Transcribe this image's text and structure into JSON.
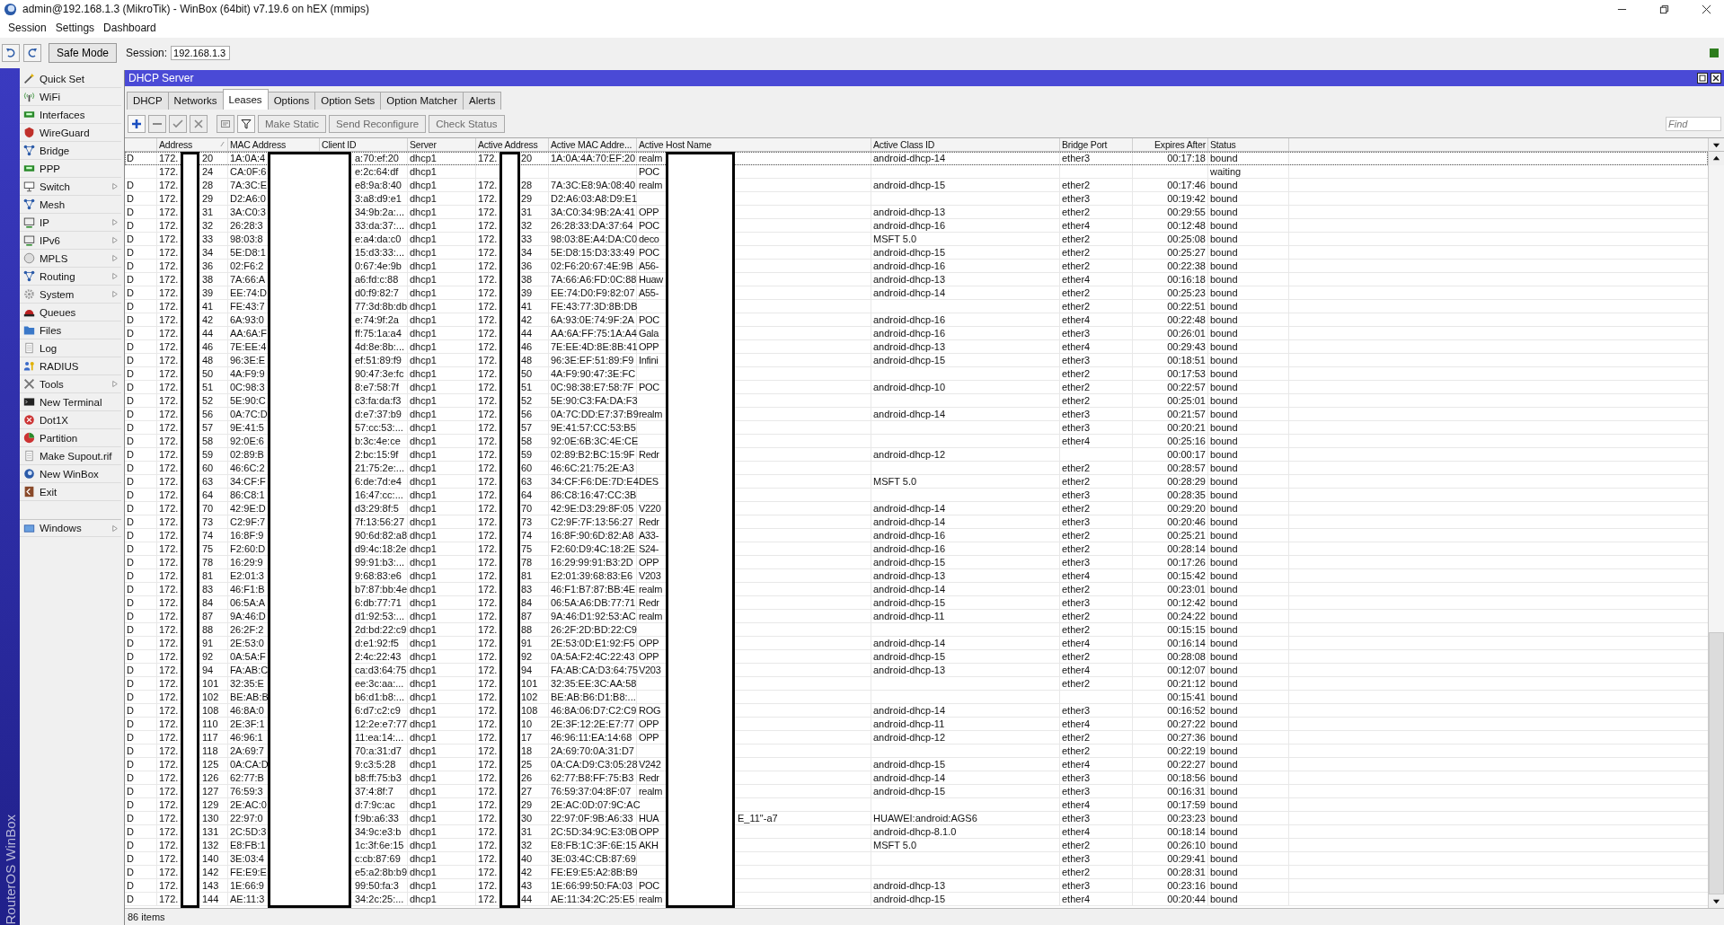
{
  "window": {
    "title": "admin@192.168.1.3 (MikroTik) - WinBox (64bit) v7.19.6 on hEX (mmips)"
  },
  "menu": [
    "Session",
    "Settings",
    "Dashboard"
  ],
  "toolbar": {
    "safe_mode": "Safe Mode",
    "session_label": "Session:",
    "session_value": "192.168.1.3"
  },
  "sidebar": {
    "brand": "RouterOS WinBox",
    "items": [
      {
        "label": "Quick Set",
        "submenu": false,
        "separated": false
      },
      {
        "label": "WiFi",
        "submenu": false,
        "separated": false
      },
      {
        "label": "Interfaces",
        "submenu": false,
        "separated": false
      },
      {
        "label": "WireGuard",
        "submenu": false,
        "separated": false
      },
      {
        "label": "Bridge",
        "submenu": false,
        "separated": false
      },
      {
        "label": "PPP",
        "submenu": false,
        "separated": false
      },
      {
        "label": "Switch",
        "submenu": true,
        "separated": false
      },
      {
        "label": "Mesh",
        "submenu": false,
        "separated": false
      },
      {
        "label": "IP",
        "submenu": true,
        "separated": false
      },
      {
        "label": "IPv6",
        "submenu": true,
        "separated": false
      },
      {
        "label": "MPLS",
        "submenu": true,
        "separated": false
      },
      {
        "label": "Routing",
        "submenu": true,
        "separated": false
      },
      {
        "label": "System",
        "submenu": true,
        "separated": false
      },
      {
        "label": "Queues",
        "submenu": false,
        "separated": false
      },
      {
        "label": "Files",
        "submenu": false,
        "separated": false
      },
      {
        "label": "Log",
        "submenu": false,
        "separated": false
      },
      {
        "label": "RADIUS",
        "submenu": false,
        "separated": false
      },
      {
        "label": "Tools",
        "submenu": true,
        "separated": false
      },
      {
        "label": "New Terminal",
        "submenu": false,
        "separated": false
      },
      {
        "label": "Dot1X",
        "submenu": false,
        "separated": false
      },
      {
        "label": "Partition",
        "submenu": false,
        "separated": false
      },
      {
        "label": "Make Supout.rif",
        "submenu": false,
        "separated": false
      },
      {
        "label": "New WinBox",
        "submenu": false,
        "separated": false
      },
      {
        "label": "Exit",
        "submenu": false,
        "separated": false
      },
      {
        "label": "Windows",
        "submenu": true,
        "separated": true
      }
    ]
  },
  "dhcp_window": {
    "title": "DHCP Server",
    "tabs": [
      {
        "label": "DHCP",
        "selected": false
      },
      {
        "label": "Networks",
        "selected": false
      },
      {
        "label": "Leases",
        "selected": true
      },
      {
        "label": "Options",
        "selected": false
      },
      {
        "label": "Option Sets",
        "selected": false
      },
      {
        "label": "Option Matcher",
        "selected": false
      },
      {
        "label": "Alerts",
        "selected": false
      }
    ],
    "tool_icons": [
      {
        "disabled": false
      },
      {
        "disabled": true
      },
      {
        "disabled": true
      },
      {
        "disabled": true
      },
      {
        "disabled": true
      },
      {
        "disabled": false
      }
    ],
    "buttons": [
      {
        "label": "Make Static",
        "disabled": true
      },
      {
        "label": "Send Reconfigure",
        "disabled": true
      },
      {
        "label": "Check Status",
        "disabled": true
      }
    ],
    "find": {
      "placeholder": "Find"
    },
    "table": {
      "columns": [
        {
          "label": "Address",
          "sorted": true
        },
        {
          "label": "MAC Address",
          "sorted": false
        },
        {
          "label": "Client ID",
          "sorted": false
        },
        {
          "label": "Server",
          "sorted": false
        },
        {
          "label": "Active Address",
          "sorted": false
        },
        {
          "label": "Active MAC Addre...",
          "sorted": false
        },
        {
          "label": "Active Host Name",
          "sorted": false
        },
        {
          "label": "Active Class ID",
          "sorted": false
        },
        {
          "label": "Bridge Port",
          "sorted": false
        },
        {
          "label": "Expires After",
          "sorted": false
        },
        {
          "label": "Status",
          "sorted": false
        }
      ],
      "rows": [
        {
          "flag": "D",
          "address": [
            "172.",
            "20"
          ],
          "mac": "1A:0A:4",
          "client_id": "a:70:ef:20",
          "server": "dhcp1",
          "active_address": [
            "172.",
            "20"
          ],
          "active_mac": "1A:0A:4A:70:EF:20",
          "host": [
            "realm"
          ],
          "class_id": "android-dhcp-14",
          "bridge_port": "ether3",
          "expires": "00:17:18",
          "status": "bound",
          "selected": true
        },
        {
          "address": [
            "172.",
            "24"
          ],
          "mac": "CA:0F:6",
          "client_id": "e:2c:64:df",
          "server": "dhcp1",
          "host": [
            "POC"
          ],
          "status": "waiting",
          "selected": false
        },
        {
          "flag": "D",
          "address": [
            "172.",
            "28"
          ],
          "mac": "7A:3C:E",
          "client_id": "e8:9a:8:40",
          "server": "dhcp1",
          "active_address": [
            "172.",
            "28"
          ],
          "active_mac": "7A:3C:E8:9A:08:40",
          "host": [
            "realm"
          ],
          "class_id": "android-dhcp-15",
          "bridge_port": "ether2",
          "expires": "00:17:46",
          "status": "bound",
          "selected": false
        },
        {
          "flag": "D",
          "address": [
            "172.",
            "29"
          ],
          "mac": "D2:A6:0",
          "client_id": "3:a8:d9:e1",
          "server": "dhcp1",
          "active_address": [
            "172.",
            "29"
          ],
          "active_mac": "D2:A6:03:A8:D9:E1",
          "bridge_port": "ether3",
          "expires": "00:19:42",
          "status": "bound",
          "selected": false
        },
        {
          "flag": "D",
          "address": [
            "172.",
            "31"
          ],
          "mac": "3A:C0:3",
          "client_id": "34:9b:2a:...",
          "server": "dhcp1",
          "active_address": [
            "172.",
            "31"
          ],
          "active_mac": "3A:C0:34:9B:2A:41",
          "host": [
            "OPP"
          ],
          "class_id": "android-dhcp-13",
          "bridge_port": "ether2",
          "expires": "00:29:55",
          "status": "bound",
          "selected": false
        },
        {
          "flag": "D",
          "address": [
            "172.",
            "32"
          ],
          "mac": "26:28:3",
          "client_id": "33:da:37:...",
          "server": "dhcp1",
          "active_address": [
            "172.",
            "32"
          ],
          "active_mac": "26:28:33:DA:37:64",
          "host": [
            "POC"
          ],
          "class_id": "android-dhcp-16",
          "bridge_port": "ether4",
          "expires": "00:12:48",
          "status": "bound",
          "selected": false
        },
        {
          "flag": "D",
          "address": [
            "172.",
            "33"
          ],
          "mac": "98:03:8",
          "client_id": "e:a4:da:c0",
          "server": "dhcp1",
          "active_address": [
            "172.",
            "33"
          ],
          "active_mac": "98:03:8E:A4:DA:C0",
          "host": [
            "deco"
          ],
          "class_id": "MSFT 5.0",
          "bridge_port": "ether2",
          "expires": "00:25:08",
          "status": "bound",
          "selected": false
        },
        {
          "flag": "D",
          "address": [
            "172.",
            "34"
          ],
          "mac": "5E:D8:1",
          "client_id": "15:d3:33:...",
          "server": "dhcp1",
          "active_address": [
            "172.",
            "34"
          ],
          "active_mac": "5E:D8:15:D3:33:49",
          "host": [
            "POC"
          ],
          "class_id": "android-dhcp-15",
          "bridge_port": "ether2",
          "expires": "00:25:27",
          "status": "bound",
          "selected": false
        },
        {
          "flag": "D",
          "address": [
            "172.",
            "36"
          ],
          "mac": "02:F6:2",
          "client_id": "0:67:4e:9b",
          "server": "dhcp1",
          "active_address": [
            "172.",
            "36"
          ],
          "active_mac": "02:F6:20:67:4E:9B",
          "host": [
            "A56-"
          ],
          "class_id": "android-dhcp-16",
          "bridge_port": "ether2",
          "expires": "00:22:38",
          "status": "bound",
          "selected": false
        },
        {
          "flag": "D",
          "address": [
            "172.",
            "38"
          ],
          "mac": "7A:66:A",
          "client_id": "a6:fd:c:88",
          "server": "dhcp1",
          "active_address": [
            "172.",
            "38"
          ],
          "active_mac": "7A:66:A6:FD:0C:88",
          "host": [
            "Huaw"
          ],
          "class_id": "android-dhcp-13",
          "bridge_port": "ether4",
          "expires": "00:16:18",
          "status": "bound",
          "selected": false
        },
        {
          "flag": "D",
          "address": [
            "172.",
            "39"
          ],
          "mac": "EE:74:D",
          "client_id": "d0:f9:82:7",
          "server": "dhcp1",
          "active_address": [
            "172.",
            "39"
          ],
          "active_mac": "EE:74:D0:F9:82:07",
          "host": [
            "A55-"
          ],
          "class_id": "android-dhcp-14",
          "bridge_port": "ether2",
          "expires": "00:25:23",
          "status": "bound",
          "selected": false
        },
        {
          "flag": "D",
          "address": [
            "172.",
            "41"
          ],
          "mac": "FE:43:7",
          "client_id": "77:3d:8b:db",
          "server": "dhcp1",
          "active_address": [
            "172.",
            "41"
          ],
          "active_mac": "FE:43:77:3D:8B:DB",
          "bridge_port": "ether2",
          "expires": "00:22:51",
          "status": "bound",
          "selected": false
        },
        {
          "flag": "D",
          "address": [
            "172.",
            "42"
          ],
          "mac": "6A:93:0",
          "client_id": "e:74:9f:2a",
          "server": "dhcp1",
          "active_address": [
            "172.",
            "42"
          ],
          "active_mac": "6A:93:0E:74:9F:2A",
          "host": [
            "POC"
          ],
          "class_id": "android-dhcp-16",
          "bridge_port": "ether4",
          "expires": "00:22:48",
          "status": "bound",
          "selected": false
        },
        {
          "flag": "D",
          "address": [
            "172.",
            "44"
          ],
          "mac": "AA:6A:F",
          "client_id": "ff:75:1a:a4",
          "server": "dhcp1",
          "active_address": [
            "172.",
            "44"
          ],
          "active_mac": "AA:6A:FF:75:1A:A4",
          "host": [
            "Gala"
          ],
          "class_id": "android-dhcp-16",
          "bridge_port": "ether3",
          "expires": "00:26:01",
          "status": "bound",
          "selected": false
        },
        {
          "flag": "D",
          "address": [
            "172.",
            "46"
          ],
          "mac": "7E:EE:4",
          "client_id": "4d:8e:8b:...",
          "server": "dhcp1",
          "active_address": [
            "172.",
            "46"
          ],
          "active_mac": "7E:EE:4D:8E:8B:41",
          "host": [
            "OPP"
          ],
          "class_id": "android-dhcp-13",
          "bridge_port": "ether4",
          "expires": "00:29:43",
          "status": "bound",
          "selected": false
        },
        {
          "flag": "D",
          "address": [
            "172.",
            "48"
          ],
          "mac": "96:3E:E",
          "client_id": "ef:51:89:f9",
          "server": "dhcp1",
          "active_address": [
            "172.",
            "48"
          ],
          "active_mac": "96:3E:EF:51:89:F9",
          "host": [
            "Infini"
          ],
          "class_id": "android-dhcp-15",
          "bridge_port": "ether3",
          "expires": "00:18:51",
          "status": "bound",
          "selected": false
        },
        {
          "flag": "D",
          "address": [
            "172.",
            "50"
          ],
          "mac": "4A:F9:9",
          "client_id": "90:47:3e:fc",
          "server": "dhcp1",
          "active_address": [
            "172.",
            "50"
          ],
          "active_mac": "4A:F9:90:47:3E:FC",
          "bridge_port": "ether2",
          "expires": "00:17:53",
          "status": "bound",
          "selected": false
        },
        {
          "flag": "D",
          "address": [
            "172.",
            "51"
          ],
          "mac": "0C:98:3",
          "client_id": "8:e7:58:7f",
          "server": "dhcp1",
          "active_address": [
            "172.",
            "51"
          ],
          "active_mac": "0C:98:38:E7:58:7F",
          "host": [
            "POC"
          ],
          "class_id": "android-dhcp-10",
          "bridge_port": "ether2",
          "expires": "00:22:57",
          "status": "bound",
          "selected": false
        },
        {
          "flag": "D",
          "address": [
            "172.",
            "52"
          ],
          "mac": "5E:90:C",
          "client_id": "c3:fa:da:f3",
          "server": "dhcp1",
          "active_address": [
            "172.",
            "52"
          ],
          "active_mac": "5E:90:C3:FA:DA:F3",
          "bridge_port": "ether2",
          "expires": "00:25:01",
          "status": "bound",
          "selected": false
        },
        {
          "flag": "D",
          "address": [
            "172.",
            "56"
          ],
          "mac": "0A:7C:D",
          "client_id": "d:e7:37:b9",
          "server": "dhcp1",
          "active_address": [
            "172.",
            "56"
          ],
          "active_mac": "0A:7C:DD:E7:37:B9",
          "host": [
            "realm"
          ],
          "class_id": "android-dhcp-14",
          "bridge_port": "ether3",
          "expires": "00:21:57",
          "status": "bound",
          "selected": false
        },
        {
          "flag": "D",
          "address": [
            "172.",
            "57"
          ],
          "mac": "9E:41:5",
          "client_id": "57:cc:53:...",
          "server": "dhcp1",
          "active_address": [
            "172.",
            "57"
          ],
          "active_mac": "9E:41:57:CC:53:B5",
          "bridge_port": "ether3",
          "expires": "00:20:21",
          "status": "bound",
          "selected": false
        },
        {
          "flag": "D",
          "address": [
            "172.",
            "58"
          ],
          "mac": "92:0E:6",
          "client_id": "b:3c:4e:ce",
          "server": "dhcp1",
          "active_address": [
            "172.",
            "58"
          ],
          "active_mac": "92:0E:6B:3C:4E:CE",
          "bridge_port": "ether4",
          "expires": "00:25:16",
          "status": "bound",
          "selected": false
        },
        {
          "flag": "D",
          "address": [
            "172.",
            "59"
          ],
          "mac": "02:89:B",
          "client_id": "2:bc:15:9f",
          "server": "dhcp1",
          "active_address": [
            "172.",
            "59"
          ],
          "active_mac": "02:89:B2:BC:15:9F",
          "host": [
            "Redr"
          ],
          "class_id": "android-dhcp-12",
          "expires": "00:00:17",
          "status": "bound",
          "selected": false
        },
        {
          "flag": "D",
          "address": [
            "172.",
            "60"
          ],
          "mac": "46:6C:2",
          "client_id": "21:75:2e:...",
          "server": "dhcp1",
          "active_address": [
            "172.",
            "60"
          ],
          "active_mac": "46:6C:21:75:2E:A3",
          "bridge_port": "ether2",
          "expires": "00:28:57",
          "status": "bound",
          "selected": false
        },
        {
          "flag": "D",
          "address": [
            "172.",
            "63"
          ],
          "mac": "34:CF:F",
          "client_id": "6:de:7d:e4",
          "server": "dhcp1",
          "active_address": [
            "172.",
            "63"
          ],
          "active_mac": "34:CF:F6:DE:7D:E4",
          "host": [
            "DES"
          ],
          "class_id": "MSFT 5.0",
          "bridge_port": "ether2",
          "expires": "00:28:29",
          "status": "bound",
          "selected": false
        },
        {
          "flag": "D",
          "address": [
            "172.",
            "64"
          ],
          "mac": "86:C8:1",
          "client_id": "16:47:cc:...",
          "server": "dhcp1",
          "active_address": [
            "172.",
            "64"
          ],
          "active_mac": "86:C8:16:47:CC:3B",
          "bridge_port": "ether3",
          "expires": "00:28:35",
          "status": "bound",
          "selected": false
        },
        {
          "flag": "D",
          "address": [
            "172.",
            "70"
          ],
          "mac": "42:9E:D",
          "client_id": "d3:29:8f:5",
          "server": "dhcp1",
          "active_address": [
            "172.",
            "70"
          ],
          "active_mac": "42:9E:D3:29:8F:05",
          "host": [
            "V220"
          ],
          "class_id": "android-dhcp-14",
          "bridge_port": "ether2",
          "expires": "00:29:20",
          "status": "bound",
          "selected": false
        },
        {
          "flag": "D",
          "address": [
            "172.",
            "73"
          ],
          "mac": "C2:9F:7",
          "client_id": "7f:13:56:27",
          "server": "dhcp1",
          "active_address": [
            "172.",
            "73"
          ],
          "active_mac": "C2:9F:7F:13:56:27",
          "host": [
            "Redr"
          ],
          "class_id": "android-dhcp-14",
          "bridge_port": "ether3",
          "expires": "00:20:46",
          "status": "bound",
          "selected": false
        },
        {
          "flag": "D",
          "address": [
            "172.",
            "74"
          ],
          "mac": "16:8F:9",
          "client_id": "90:6d:82:a8",
          "server": "dhcp1",
          "active_address": [
            "172.",
            "74"
          ],
          "active_mac": "16:8F:90:6D:82:A8",
          "host": [
            "A33-"
          ],
          "class_id": "android-dhcp-16",
          "bridge_port": "ether2",
          "expires": "00:25:21",
          "status": "bound",
          "selected": false
        },
        {
          "flag": "D",
          "address": [
            "172.",
            "75"
          ],
          "mac": "F2:60:D",
          "client_id": "d9:4c:18:2e",
          "server": "dhcp1",
          "active_address": [
            "172.",
            "75"
          ],
          "active_mac": "F2:60:D9:4C:18:2E",
          "host": [
            "S24-"
          ],
          "class_id": "android-dhcp-16",
          "bridge_port": "ether2",
          "expires": "00:28:14",
          "status": "bound",
          "selected": false
        },
        {
          "flag": "D",
          "address": [
            "172.",
            "78"
          ],
          "mac": "16:29:9",
          "client_id": "99:91:b3:...",
          "server": "dhcp1",
          "active_address": [
            "172.",
            "78"
          ],
          "active_mac": "16:29:99:91:B3:2D",
          "host": [
            "OPP"
          ],
          "class_id": "android-dhcp-15",
          "bridge_port": "ether3",
          "expires": "00:17:26",
          "status": "bound",
          "selected": false
        },
        {
          "flag": "D",
          "address": [
            "172.",
            "81"
          ],
          "mac": "E2:01:3",
          "client_id": "9:68:83:e6",
          "server": "dhcp1",
          "active_address": [
            "172.",
            "81"
          ],
          "active_mac": "E2:01:39:68:83:E6",
          "host": [
            "V203"
          ],
          "class_id": "android-dhcp-13",
          "bridge_port": "ether4",
          "expires": "00:15:42",
          "status": "bound",
          "selected": false
        },
        {
          "flag": "D",
          "address": [
            "172.",
            "83"
          ],
          "mac": "46:F1:B",
          "client_id": "b7:87:bb:4e",
          "server": "dhcp1",
          "active_address": [
            "172.",
            "83"
          ],
          "active_mac": "46:F1:B7:87:BB:4E",
          "host": [
            "realm"
          ],
          "class_id": "android-dhcp-14",
          "bridge_port": "ether2",
          "expires": "00:23:01",
          "status": "bound",
          "selected": false
        },
        {
          "flag": "D",
          "address": [
            "172.",
            "84"
          ],
          "mac": "06:5A:A",
          "client_id": "6:db:77:71",
          "server": "dhcp1",
          "active_address": [
            "172.",
            "84"
          ],
          "active_mac": "06:5A:A6:DB:77:71",
          "host": [
            "Redr"
          ],
          "class_id": "android-dhcp-15",
          "bridge_port": "ether3",
          "expires": "00:12:42",
          "status": "bound",
          "selected": false
        },
        {
          "flag": "D",
          "address": [
            "172.",
            "87"
          ],
          "mac": "9A:46:D",
          "client_id": "d1:92:53:...",
          "server": "dhcp1",
          "active_address": [
            "172.",
            "87"
          ],
          "active_mac": "9A:46:D1:92:53:AC",
          "host": [
            "realm"
          ],
          "class_id": "android-dhcp-11",
          "bridge_port": "ether2",
          "expires": "00:24:22",
          "status": "bound",
          "selected": false
        },
        {
          "flag": "D",
          "address": [
            "172.",
            "88"
          ],
          "mac": "26:2F:2",
          "client_id": "2d:bd:22:c9",
          "server": "dhcp1",
          "active_address": [
            "172.",
            "88"
          ],
          "active_mac": "26:2F:2D:BD:22:C9",
          "bridge_port": "ether2",
          "expires": "00:15:15",
          "status": "bound",
          "selected": false
        },
        {
          "flag": "D",
          "address": [
            "172.",
            "91"
          ],
          "mac": "2E:53:0",
          "client_id": "d:e1:92:f5",
          "server": "dhcp1",
          "active_address": [
            "172.",
            "91"
          ],
          "active_mac": "2E:53:0D:E1:92:F5",
          "host": [
            "OPP"
          ],
          "class_id": "android-dhcp-14",
          "bridge_port": "ether4",
          "expires": "00:16:14",
          "status": "bound",
          "selected": false
        },
        {
          "flag": "D",
          "address": [
            "172.",
            "92"
          ],
          "mac": "0A:5A:F",
          "client_id": "2:4c:22:43",
          "server": "dhcp1",
          "active_address": [
            "172.",
            "92"
          ],
          "active_mac": "0A:5A:F2:4C:22:43",
          "host": [
            "OPP"
          ],
          "class_id": "android-dhcp-15",
          "bridge_port": "ether2",
          "expires": "00:28:08",
          "status": "bound",
          "selected": false
        },
        {
          "flag": "D",
          "address": [
            "172.",
            "94"
          ],
          "mac": "FA:AB:C",
          "client_id": "ca:d3:64:75",
          "server": "dhcp1",
          "active_address": [
            "172.",
            "94"
          ],
          "active_mac": "FA:AB:CA:D3:64:75",
          "host": [
            "V203"
          ],
          "class_id": "android-dhcp-13",
          "bridge_port": "ether4",
          "expires": "00:12:07",
          "status": "bound",
          "selected": false
        },
        {
          "flag": "D",
          "address": [
            "172.",
            "101"
          ],
          "mac": "32:35:E",
          "client_id": "ee:3c:aa:...",
          "server": "dhcp1",
          "active_address": [
            "172.",
            "101"
          ],
          "active_mac": "32:35:EE:3C:AA:58",
          "bridge_port": "ether2",
          "expires": "00:21:12",
          "status": "bound",
          "selected": false
        },
        {
          "flag": "D",
          "address": [
            "172.",
            "102"
          ],
          "mac": "BE:AB:B",
          "client_id": "b6:d1:b8:...",
          "server": "dhcp1",
          "active_address": [
            "172.",
            "102"
          ],
          "active_mac": "BE:AB:B6:D1:B8:...",
          "expires": "00:15:41",
          "status": "bound",
          "selected": false
        },
        {
          "flag": "D",
          "address": [
            "172.",
            "108"
          ],
          "mac": "46:8A:0",
          "client_id": "6:d7:c2:c9",
          "server": "dhcp1",
          "active_address": [
            "172.",
            "108"
          ],
          "active_mac": "46:8A:06:D7:C2:C9",
          "host": [
            "ROG"
          ],
          "class_id": "android-dhcp-14",
          "bridge_port": "ether3",
          "expires": "00:16:52",
          "status": "bound",
          "selected": false
        },
        {
          "flag": "D",
          "address": [
            "172.",
            "110"
          ],
          "mac": "2E:3F:1",
          "client_id": "12:2e:e7:77",
          "server": "dhcp1",
          "active_address": [
            "172.",
            "10"
          ],
          "active_mac": "2E:3F:12:2E:E7:77",
          "host": [
            "OPP"
          ],
          "class_id": "android-dhcp-11",
          "bridge_port": "ether4",
          "expires": "00:27:22",
          "status": "bound",
          "selected": false
        },
        {
          "flag": "D",
          "address": [
            "172.",
            "117"
          ],
          "mac": "46:96:1",
          "client_id": "11:ea:14:...",
          "server": "dhcp1",
          "active_address": [
            "172.",
            "17"
          ],
          "active_mac": "46:96:11:EA:14:68",
          "host": [
            "OPP"
          ],
          "class_id": "android-dhcp-12",
          "bridge_port": "ether2",
          "expires": "00:27:36",
          "status": "bound",
          "selected": false
        },
        {
          "flag": "D",
          "address": [
            "172.",
            "118"
          ],
          "mac": "2A:69:7",
          "client_id": "70:a:31:d7",
          "server": "dhcp1",
          "active_address": [
            "172.",
            "18"
          ],
          "active_mac": "2A:69:70:0A:31:D7",
          "bridge_port": "ether2",
          "expires": "00:22:19",
          "status": "bound",
          "selected": false
        },
        {
          "flag": "D",
          "address": [
            "172.",
            "125"
          ],
          "mac": "0A:CA:D",
          "client_id": "9:c3:5:28",
          "server": "dhcp1",
          "active_address": [
            "172.",
            "25"
          ],
          "active_mac": "0A:CA:D9:C3:05:28",
          "host": [
            "V242"
          ],
          "class_id": "android-dhcp-15",
          "bridge_port": "ether4",
          "expires": "00:22:27",
          "status": "bound",
          "selected": false
        },
        {
          "flag": "D",
          "address": [
            "172.",
            "126"
          ],
          "mac": "62:77:B",
          "client_id": "b8:ff:75:b3",
          "server": "dhcp1",
          "active_address": [
            "172.",
            "26"
          ],
          "active_mac": "62:77:B8:FF:75:B3",
          "host": [
            "Redr"
          ],
          "class_id": "android-dhcp-14",
          "bridge_port": "ether3",
          "expires": "00:18:56",
          "status": "bound",
          "selected": false
        },
        {
          "flag": "D",
          "address": [
            "172.",
            "127"
          ],
          "mac": "76:59:3",
          "client_id": "37:4:8f:7",
          "server": "dhcp1",
          "active_address": [
            "172.",
            "27"
          ],
          "active_mac": "76:59:37:04:8F:07",
          "host": [
            "realm"
          ],
          "class_id": "android-dhcp-15",
          "bridge_port": "ether3",
          "expires": "00:16:31",
          "status": "bound",
          "selected": false
        },
        {
          "flag": "D",
          "address": [
            "172.",
            "129"
          ],
          "mac": "2E:AC:0",
          "client_id": "d:7:9c:ac",
          "server": "dhcp1",
          "active_address": [
            "172.",
            "29"
          ],
          "active_mac": "2E:AC:0D:07:9C:AC",
          "bridge_port": "ether4",
          "expires": "00:17:59",
          "status": "bound",
          "selected": false
        },
        {
          "flag": "D",
          "address": [
            "172.",
            "130"
          ],
          "mac": "22:97:0",
          "client_id": "f:9b:a6:33",
          "server": "dhcp1",
          "active_address": [
            "172.",
            "30"
          ],
          "active_mac": "22:97:0F:9B:A6:33",
          "host": [
            "HUA",
            "E_11\"-a7"
          ],
          "class_id": "HUAWEI:android:AGS6",
          "bridge_port": "ether3",
          "expires": "00:23:23",
          "status": "bound",
          "selected": false
        },
        {
          "flag": "D",
          "address": [
            "172.",
            "131"
          ],
          "mac": "2C:5D:3",
          "client_id": "34:9c:e3:b",
          "server": "dhcp1",
          "active_address": [
            "172.",
            "31"
          ],
          "active_mac": "2C:5D:34:9C:E3:0B",
          "host": [
            "OPP"
          ],
          "class_id": "android-dhcp-8.1.0",
          "bridge_port": "ether4",
          "expires": "00:18:14",
          "status": "bound",
          "selected": false
        },
        {
          "flag": "D",
          "address": [
            "172.",
            "132"
          ],
          "mac": "E8:FB:1",
          "client_id": "1c:3f:6e:15",
          "server": "dhcp1",
          "active_address": [
            "172.",
            "32"
          ],
          "active_mac": "E8:FB:1C:3F:6E:15",
          "host": [
            "AKH"
          ],
          "class_id": "MSFT 5.0",
          "bridge_port": "ether2",
          "expires": "00:26:10",
          "status": "bound",
          "selected": false
        },
        {
          "flag": "D",
          "address": [
            "172.",
            "140"
          ],
          "mac": "3E:03:4",
          "client_id": "c:cb:87:69",
          "server": "dhcp1",
          "active_address": [
            "172.",
            "40"
          ],
          "active_mac": "3E:03:4C:CB:87:69",
          "bridge_port": "ether3",
          "expires": "00:29:41",
          "status": "bound",
          "selected": false
        },
        {
          "flag": "D",
          "address": [
            "172.",
            "142"
          ],
          "mac": "FE:E9:E",
          "client_id": "e5:a2:8b:b9",
          "server": "dhcp1",
          "active_address": [
            "172.",
            "42"
          ],
          "active_mac": "FE:E9:E5:A2:8B:B9",
          "bridge_port": "ether2",
          "expires": "00:28:31",
          "status": "bound",
          "selected": false
        },
        {
          "flag": "D",
          "address": [
            "172.",
            "143"
          ],
          "mac": "1E:66:9",
          "client_id": "99:50:fa:3",
          "server": "dhcp1",
          "active_address": [
            "172.",
            "43"
          ],
          "active_mac": "1E:66:99:50:FA:03",
          "host": [
            "POC"
          ],
          "class_id": "android-dhcp-13",
          "bridge_port": "ether3",
          "expires": "00:23:16",
          "status": "bound",
          "selected": false
        },
        {
          "flag": "D",
          "address": [
            "172.",
            "144"
          ],
          "mac": "AE:11:3",
          "client_id": "34:2c:25:...",
          "server": "dhcp1",
          "active_address": [
            "172.",
            "44"
          ],
          "active_mac": "AE:11:34:2C:25:E5",
          "host": [
            "realm"
          ],
          "class_id": "android-dhcp-15",
          "bridge_port": "ether4",
          "expires": "00:20:44",
          "status": "bound",
          "selected": false
        }
      ]
    },
    "status_bar": "86 items"
  }
}
